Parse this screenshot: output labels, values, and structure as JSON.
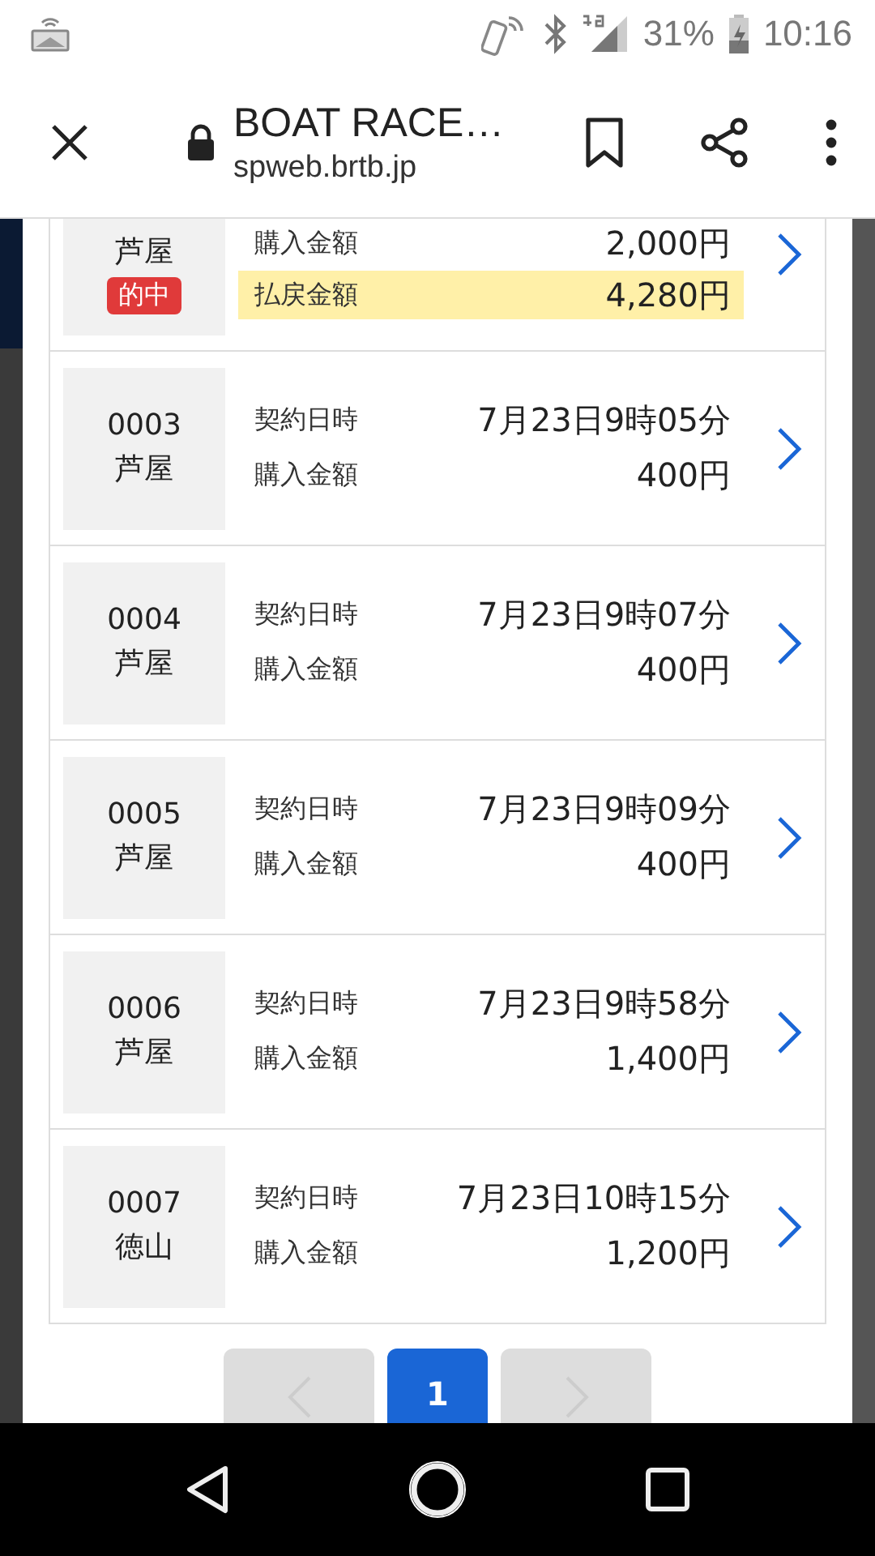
{
  "status_bar": {
    "battery": "31%",
    "time": "10:16"
  },
  "browser": {
    "title": "BOAT RACE…",
    "url": "spweb.brtb.jp"
  },
  "tickets": [
    {
      "venue": "芦屋",
      "badge": "的中",
      "lines": [
        {
          "label": "購入金額",
          "value": "2,000円",
          "highlighted": false
        },
        {
          "label": "払戻金額",
          "value": "4,280円",
          "highlighted": true
        }
      ]
    },
    {
      "code": "0003",
      "venue": "芦屋",
      "lines": [
        {
          "label": "契約日時",
          "value": "7月23日9時05分",
          "highlighted": false
        },
        {
          "label": "購入金額",
          "value": "400円",
          "highlighted": false
        }
      ]
    },
    {
      "code": "0004",
      "venue": "芦屋",
      "lines": [
        {
          "label": "契約日時",
          "value": "7月23日9時07分",
          "highlighted": false
        },
        {
          "label": "購入金額",
          "value": "400円",
          "highlighted": false
        }
      ]
    },
    {
      "code": "0005",
      "venue": "芦屋",
      "lines": [
        {
          "label": "契約日時",
          "value": "7月23日9時09分",
          "highlighted": false
        },
        {
          "label": "購入金額",
          "value": "400円",
          "highlighted": false
        }
      ]
    },
    {
      "code": "0006",
      "venue": "芦屋",
      "lines": [
        {
          "label": "契約日時",
          "value": "7月23日9時58分",
          "highlighted": false
        },
        {
          "label": "購入金額",
          "value": "1,400円",
          "highlighted": false
        }
      ]
    },
    {
      "code": "0007",
      "venue": "徳山",
      "lines": [
        {
          "label": "契約日時",
          "value": "7月23日10時15分",
          "highlighted": false
        },
        {
          "label": "購入金額",
          "value": "1,200円",
          "highlighted": false
        }
      ]
    }
  ],
  "pagination": {
    "prev_disabled": true,
    "next_disabled": true,
    "pages": [
      {
        "label": "1",
        "selected": true
      }
    ]
  }
}
